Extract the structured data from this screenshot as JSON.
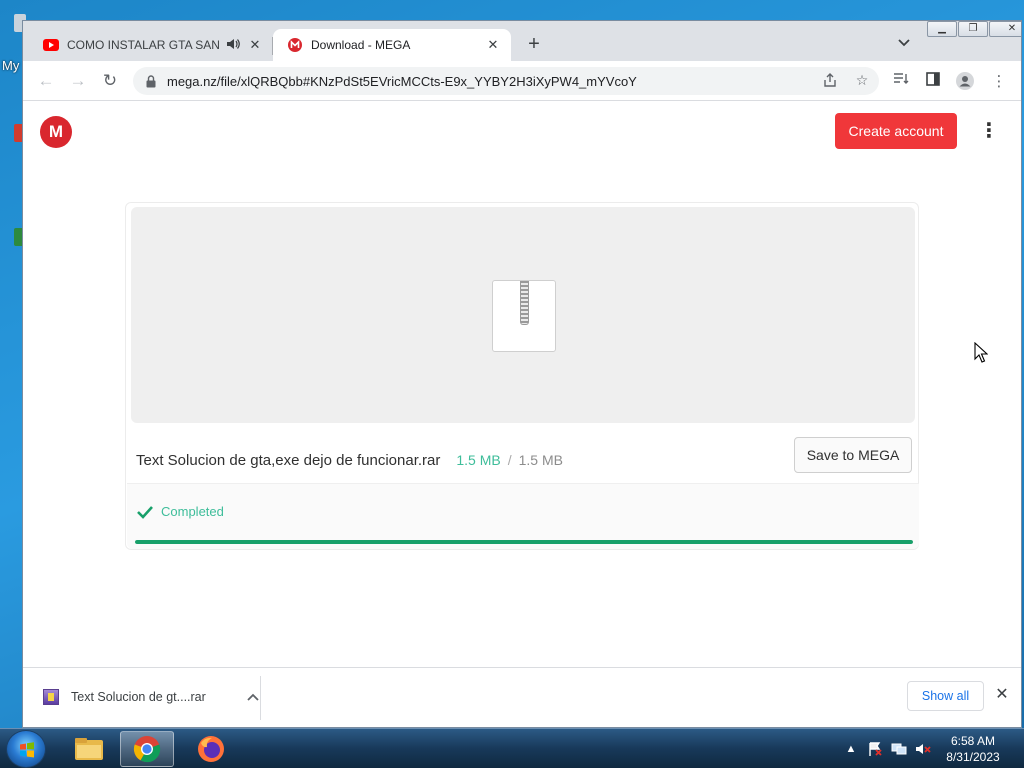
{
  "desktop": {
    "label": "My"
  },
  "browser": {
    "tabs": [
      {
        "title": "COMO INSTALAR GTA SAN A",
        "favicon": "youtube-icon",
        "audio": true,
        "active": false
      },
      {
        "title": "Download - MEGA",
        "favicon": "mega-icon",
        "active": true
      }
    ],
    "new_tab_symbol": "+",
    "url": "mega.nz/file/xlQRBQbb#KNzPdSt5EVricMCCts-E9x_YYBY2H3iXyPW4_mYVcoY"
  },
  "page": {
    "logo_letter": "M",
    "create_account_label": "Create account",
    "file": {
      "name": "Text Solucion de gta,exe dejo de funcionar.rar",
      "size_downloaded": "1.5 MB",
      "size_separator": "/",
      "size_total": "1.5 MB"
    },
    "save_label": "Save to MEGA",
    "status": "Completed",
    "progress": 1.0,
    "accent": "#f0373a",
    "success_color": "#18a06a"
  },
  "download_shelf": {
    "item_name": "Text Solucion de gt....rar",
    "show_all_label": "Show all"
  },
  "taskbar": {
    "time": "6:58 AM",
    "date": "8/31/2023"
  }
}
